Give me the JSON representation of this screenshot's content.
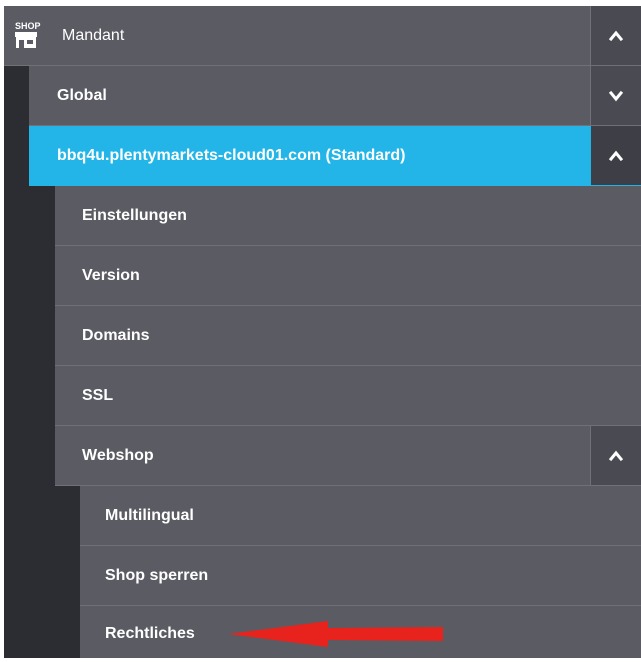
{
  "menu": {
    "root": {
      "icon_text": "SHOP",
      "icon": "shop-storefront-icon",
      "label": "Mandant",
      "toggle_icon": "chevron-up-icon"
    },
    "global": {
      "label": "Global",
      "toggle_icon": "chevron-down-icon"
    },
    "client": {
      "label": "bbq4u.plentymarkets-cloud01.com (Standard)",
      "toggle_icon": "chevron-up-icon"
    },
    "items": [
      {
        "label": "Einstellungen"
      },
      {
        "label": "Version"
      },
      {
        "label": "Domains"
      },
      {
        "label": "SSL"
      }
    ],
    "webshop": {
      "label": "Webshop",
      "toggle_icon": "chevron-up-icon"
    },
    "webshop_items": [
      {
        "label": "Multilingual"
      },
      {
        "label": "Shop sperren"
      },
      {
        "label": "Rechtliches"
      }
    ]
  },
  "colors": {
    "menu_bg": "#5a5b63",
    "toggle_bg": "#4a4b52",
    "active_bg": "#23b5e8",
    "indent_bar": "#2c2d33",
    "annotation_arrow": "#e8231d"
  },
  "annotation": {
    "icon": "red-arrow-icon"
  }
}
